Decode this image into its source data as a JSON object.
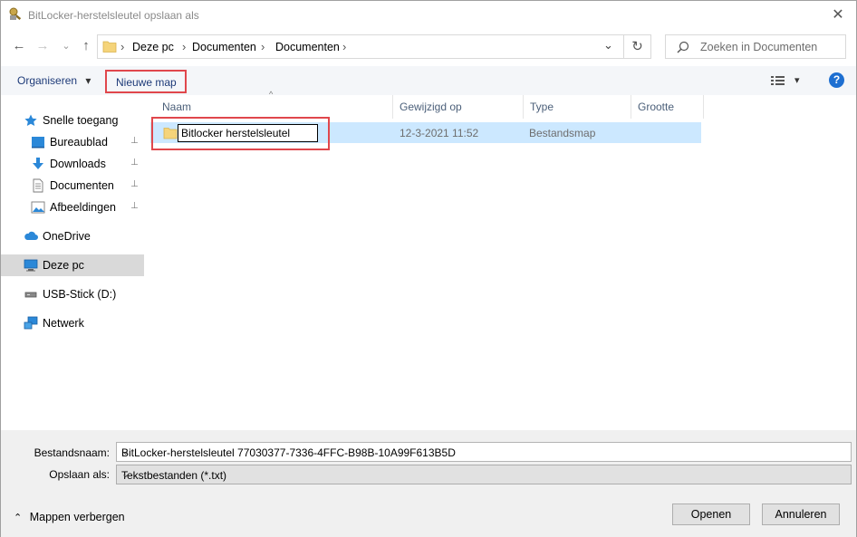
{
  "window": {
    "title": "BitLocker-herstelsleutel opslaan als",
    "close_glyph": "✕"
  },
  "nav": {
    "back_glyph": "←",
    "forward_glyph": "→",
    "recent_glyph": "⌄",
    "up_glyph": "↑",
    "refresh_glyph": "↻"
  },
  "address": {
    "segments": [
      "Deze pc",
      "Documenten",
      "Documenten"
    ],
    "separator": "›",
    "dropdown_glyph": "⌄"
  },
  "search": {
    "placeholder": "Zoeken in Documenten"
  },
  "toolbar": {
    "organize_label": "Organiseren",
    "organize_arrow": "▾",
    "new_folder_label": "Nieuwe map",
    "view_arrow": "▾",
    "help_label": "?"
  },
  "sidebar": {
    "items": [
      {
        "label": "Snelle toegang",
        "icon": "star-icon"
      },
      {
        "label": "Bureaublad",
        "icon": "desktop-icon",
        "pinned": true
      },
      {
        "label": "Downloads",
        "icon": "download-icon",
        "pinned": true
      },
      {
        "label": "Documenten",
        "icon": "document-icon",
        "pinned": true
      },
      {
        "label": "Afbeeldingen",
        "icon": "pictures-icon",
        "pinned": true
      },
      {
        "label": "OneDrive",
        "icon": "cloud-icon"
      },
      {
        "label": "Deze pc",
        "icon": "computer-icon",
        "selected": true
      },
      {
        "label": "USB-Stick (D:)",
        "icon": "usb-drive-icon"
      },
      {
        "label": "Netwerk",
        "icon": "network-icon"
      }
    ],
    "pin_glyph": "📌"
  },
  "columns": {
    "name": "Naam",
    "modified": "Gewijzigd op",
    "type": "Type",
    "size": "Grootte",
    "sort_glyph": "^"
  },
  "files": [
    {
      "name": "Bitlocker herstelsleutel",
      "modified": "12-3-2021 11:52",
      "type": "Bestandsmap",
      "size": ""
    }
  ],
  "form": {
    "filename_label": "Bestandsnaam:",
    "filename_value": "BitLocker-herstelsleutel 77030377-7336-4FFC-B98B-10A99F613B5D",
    "savetype_label": "Opslaan als:",
    "savetype_value": "Tekstbestanden (*.txt)",
    "dropdown_glyph": "⌄"
  },
  "footer": {
    "hide_folders_label": "Mappen verbergen",
    "hide_folders_arrow": "⌃",
    "open_label": "Openen",
    "cancel_label": "Annuleren"
  },
  "colors": {
    "accent": "#1e6fd1",
    "highlight_box": "#e0474c",
    "selection": "#cce8ff",
    "folder": "#f5d47a"
  }
}
